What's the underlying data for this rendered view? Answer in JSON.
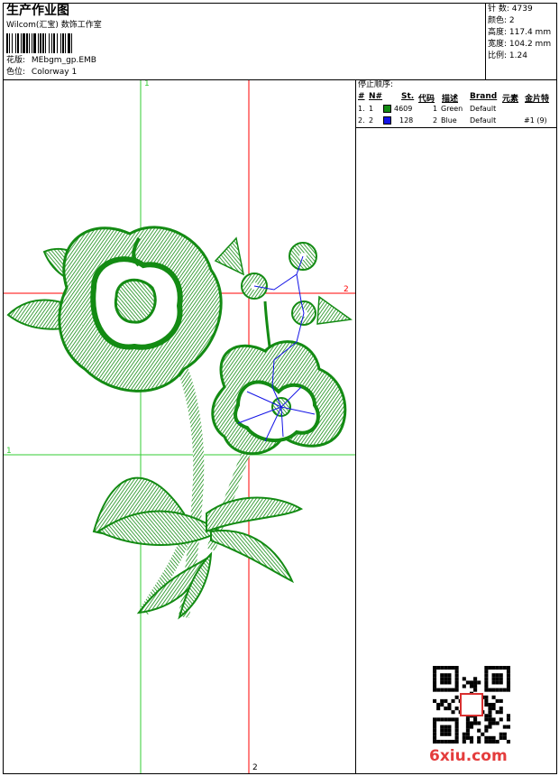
{
  "header": {
    "title": "生产作业图",
    "company": "Wilcom(汇宝) 数饰工作室",
    "design_label": "花版:",
    "design_value": "MEbgm_gp.EMB",
    "colorway_label": "色位:",
    "colorway_value": "Colorway 1"
  },
  "stats": [
    {
      "label": "针 数:",
      "value": "4739"
    },
    {
      "label": "颜色:",
      "value": "2"
    },
    {
      "label": "高度:",
      "value": "117.4 mm"
    },
    {
      "label": "宽度:",
      "value": "104.2 mm"
    },
    {
      "label": "比例:",
      "value": "1.24"
    }
  ],
  "stop_sequence": {
    "title": "停止顺序:",
    "headers": [
      "#",
      "N#",
      "St.",
      "代码",
      "描述",
      "Brand",
      "元素",
      "金片特"
    ],
    "rows": [
      {
        "n": "1.",
        "needle": "1",
        "color": "#138b13",
        "stitches": "4609",
        "code": "1",
        "desc": "Green",
        "brand": "Default",
        "element": "",
        "sequin": ""
      },
      {
        "n": "2.",
        "needle": "2",
        "color": "#1414e6",
        "stitches": "128",
        "code": "2",
        "desc": "Blue",
        "brand": "Default",
        "element": "",
        "sequin": "#1 (9)"
      }
    ]
  },
  "guides": {
    "green_top": "1",
    "green_left": "1",
    "red_right": "2",
    "red_bottom": "2"
  },
  "colors": {
    "thread_green": "#138b13",
    "thread_blue": "#1414e6",
    "guide_green": "#33cc33",
    "guide_red": "#ff0000"
  },
  "watermark": "6xiu.com"
}
